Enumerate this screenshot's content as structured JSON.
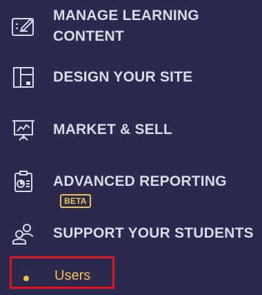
{
  "menu": {
    "items": [
      {
        "label_line1": "MANAGE LEARNING",
        "label_line2": "CONTENT",
        "icon": "edit-board-icon"
      },
      {
        "label": "DESIGN YOUR SITE",
        "icon": "layout-icon"
      },
      {
        "label": "MARKET & SELL",
        "icon": "presentation-chart-icon"
      },
      {
        "label": "ADVANCED REPORTING",
        "badge": "BETA",
        "icon": "report-icon"
      },
      {
        "label": "SUPPORT YOUR STUDENTS",
        "icon": "users-icon"
      }
    ],
    "sub_items": [
      {
        "label": "Users"
      }
    ]
  },
  "colors": {
    "background": "#2b2a4e",
    "text": "#d9dae6",
    "accent": "#f0c24a",
    "highlight_border": "#e0141e"
  }
}
